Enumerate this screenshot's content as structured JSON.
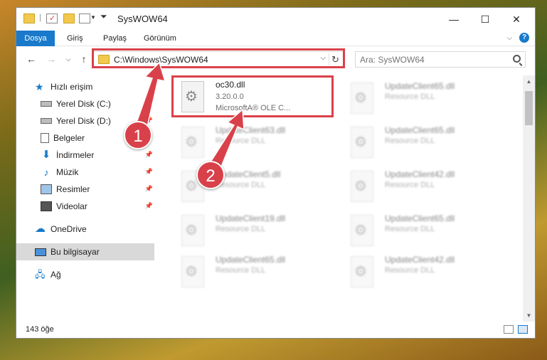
{
  "window": {
    "title": "SysWOW64",
    "controls": {
      "minimize": "—",
      "maximize": "☐",
      "close": "✕"
    }
  },
  "ribbon": {
    "tabs": [
      "Dosya",
      "Giriş",
      "Paylaş",
      "Görünüm"
    ],
    "active_tab": "Dosya",
    "accent_color": "#1979ca"
  },
  "navigation": {
    "address": "C:\\Windows\\SysWOW64",
    "search_placeholder": "Ara: SysWOW64"
  },
  "sidebar": {
    "items": [
      {
        "label": "Hızlı erişim",
        "icon": "star-icon",
        "pinned": false
      },
      {
        "label": "Yerel Disk (C:)",
        "icon": "drive-icon",
        "pinned": true
      },
      {
        "label": "Yerel Disk (D:)",
        "icon": "drive-icon",
        "pinned": true
      },
      {
        "label": "Belgeler",
        "icon": "documents-icon",
        "pinned": true
      },
      {
        "label": "İndirmeler",
        "icon": "download-icon",
        "pinned": true
      },
      {
        "label": "Müzik",
        "icon": "music-icon",
        "pinned": true
      },
      {
        "label": "Resimler",
        "icon": "pictures-icon",
        "pinned": true
      },
      {
        "label": "Videolar",
        "icon": "videos-icon",
        "pinned": true
      },
      {
        "label": "OneDrive",
        "icon": "cloud-icon",
        "pinned": false
      },
      {
        "label": "Bu bilgisayar",
        "icon": "computer-icon",
        "pinned": false,
        "selected": true
      },
      {
        "label": "Ağ",
        "icon": "network-icon",
        "pinned": false
      }
    ]
  },
  "files": {
    "highlighted": {
      "name": "oc30.dll",
      "version": "3.20.0.0",
      "description": "MicrosoftA® OLE C..."
    },
    "background": [
      {
        "name": "UpdateClient65.dll",
        "description": "Resource DLL"
      },
      {
        "name": "UpdateClient63.dll",
        "description": "Resource DLL"
      },
      {
        "name": "UpdateClient65.dll",
        "description": "Resource DLL"
      },
      {
        "name": "UpdateClient5.dll",
        "description": "Resource DLL"
      },
      {
        "name": "UpdateClient42.dll",
        "description": "Resource DLL"
      },
      {
        "name": "UpdateClient19.dll",
        "description": "Resource DLL"
      },
      {
        "name": "UpdateClient65.dll",
        "description": "Resource DLL"
      },
      {
        "name": "UpdateClient65.dll",
        "description": "Resource DLL"
      },
      {
        "name": "UpdateClient42.dll",
        "description": "Resource DLL"
      }
    ]
  },
  "status": {
    "item_count": "143 öğe"
  },
  "annotations": {
    "marker_1": "1",
    "marker_2": "2",
    "color": "#d9414a"
  }
}
